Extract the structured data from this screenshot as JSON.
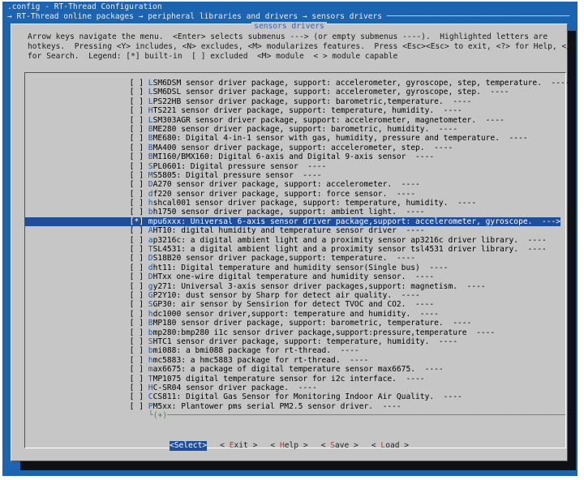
{
  "header": {
    "config_title": ".config - RT-Thread Configuration",
    "breadcrumb": "→ RT-Thread online packages → peripheral libraries and drivers → sensors drivers ───────────────────────────────────────"
  },
  "dialog": {
    "title": "sensors drivers",
    "help_lines": [
      "Arrow keys navigate the menu.  <Enter> selects submenus ---> (or empty submenus ----).  Highlighted letters are",
      "hotkeys.  Pressing <Y> includes, <N> excludes, <M> modularizes features.  Press <Esc><Esc> to exit, <?> for Help, </>",
      "for Search.  Legend: [*] built-in  [ ] excluded  <M> module  < > module capable"
    ]
  },
  "menu": {
    "items": [
      {
        "mark": "[ ]",
        "hot": "L",
        "rest": "SM6DSM sensor driver package, support: accelerometer, gyroscope, step, temperature.  ----"
      },
      {
        "mark": "[ ]",
        "hot": "L",
        "rest": "SM6DSL sensor driver package, support: accelerometer, gyroscope, step.  ----"
      },
      {
        "mark": "[ ]",
        "hot": "L",
        "rest": "PS22HB sensor driver package, support: barometric,temperature.  ----"
      },
      {
        "mark": "[ ]",
        "hot": "H",
        "rest": "TS221 sensor driver package, support: temperature, humidity.  ----"
      },
      {
        "mark": "[ ]",
        "hot": "L",
        "rest": "SM303AGR sensor driver package, support: accelerometer, magnetometer.  ----"
      },
      {
        "mark": "[ ]",
        "hot": "B",
        "rest": "ME280 sensor driver package, support: barometric, humidity.  ----"
      },
      {
        "mark": "[ ]",
        "hot": "B",
        "rest": "ME680: Digital 4-in-1 sensor with gas, humidity, pressure and temperature.  ----"
      },
      {
        "mark": "[ ]",
        "hot": "B",
        "rest": "MA400 sensor driver package, support: accelerometer, step.  ----"
      },
      {
        "mark": "[ ]",
        "hot": "B",
        "rest": "MI160/BMX160: Digital 6-axis and Digital 9-axis sensor  ----"
      },
      {
        "mark": "[ ]",
        "hot": "S",
        "rest": "PL0601: Digital pressure sensor  ----"
      },
      {
        "mark": "[ ]",
        "hot": "M",
        "rest": "S5805: Digital pressure sensor  ----"
      },
      {
        "mark": "[ ]",
        "hot": "D",
        "rest": "A270 sensor driver package, support: accelerometer.  ----"
      },
      {
        "mark": "[ ]",
        "hot": "d",
        "rest": "f220 sensor driver package, support: force sensor.  ----"
      },
      {
        "mark": "[ ]",
        "hot": "h",
        "rest": "shcal001 sensor driver package, support: temperature, humidity.  ----"
      },
      {
        "mark": "[ ]",
        "hot": "b",
        "rest": "h1750 sensor driver package, support: ambient light.  ----"
      },
      {
        "mark": "[*]",
        "hot": "m",
        "rest": "pu6xxx: Universal 6-axis sensor driver package,support: accelerometer, gyroscope.  --->",
        "selected": true
      },
      {
        "mark": "[ ]",
        "hot": "A",
        "rest": "HT10: digital humidity and temperature sensor driver  ----"
      },
      {
        "mark": "[ ]",
        "hot": "a",
        "rest": "p3216c: a digital ambient light and a proximity sensor ap3216c driver library.  ----"
      },
      {
        "mark": "[ ]",
        "hot": "T",
        "rest": "SL4531: a digital ambient light and a proximity sensor tsl4531 driver library.  ----"
      },
      {
        "mark": "[ ]",
        "hot": "D",
        "rest": "S18B20 sensor driver package,support: temperature.  ----"
      },
      {
        "mark": "[ ]",
        "hot": "d",
        "rest": "ht11: Digital temperature and humidity sensor(Single bus)  ----"
      },
      {
        "mark": "[ ]",
        "hot": "D",
        "rest": "HTxx one-wire digital temperature and humidity sensor.  ----"
      },
      {
        "mark": "[ ]",
        "hot": "g",
        "rest": "y271: Universal 3-axis sensor driver packages,support: magnetism.  ----"
      },
      {
        "mark": "[ ]",
        "hot": "G",
        "rest": "P2Y10: dust sensor by Sharp for detect air quality.  ----"
      },
      {
        "mark": "[ ]",
        "hot": "S",
        "rest": "GP30: air sensor by Sensirion for detect TVOC and CO2.  ----"
      },
      {
        "mark": "[ ]",
        "hot": "h",
        "rest": "dc1000 sensor driver,support: temperature and humidity.  ----"
      },
      {
        "mark": "[ ]",
        "hot": "B",
        "rest": "MP180 sensor driver package, support: barometric, temperature.  ----"
      },
      {
        "mark": "[ ]",
        "hot": "b",
        "rest": "mp280:bmp280 i1c sensor driver package,support:pressure,temperature  ----"
      },
      {
        "mark": "[ ]",
        "hot": "S",
        "rest": "HTC1 sensor driver package, support: temperature, humidity.  ----"
      },
      {
        "mark": "[ ]",
        "hot": "b",
        "rest": "mi088: a bmi088 package for rt-thread.  ----"
      },
      {
        "mark": "[ ]",
        "hot": "h",
        "rest": "mc5883: a hmc5883 package for rt-thread.  ----"
      },
      {
        "mark": "[ ]",
        "hot": "m",
        "rest": "ax6675: a package of digital temperature sensor max6675.  ----"
      },
      {
        "mark": "[ ]",
        "hot": "T",
        "rest": "MP1075 digital temperature sensor for i2c interface.  ----"
      },
      {
        "mark": "[ ]",
        "hot": "H",
        "rest": "C-SR04 sensor driver package.  ----"
      },
      {
        "mark": "[ ]",
        "hot": "C",
        "rest": "CS811: Digital Gas Sensor for Monitoring Indoor Air Quality.  ----"
      },
      {
        "mark": "[ ]",
        "hot": "P",
        "rest": "M5xx: Plantower pms serial PM2.5 sensor driver.  ----"
      }
    ],
    "scroll_indicator": "└(+)─────────────────────────────────────────────────────────────────────────────────────"
  },
  "buttons": [
    {
      "pre": "<",
      "hot": "S",
      "post": "elect>",
      "active": true,
      "name": "select-button"
    },
    {
      "pre": "< ",
      "hot": "E",
      "post": "xit >",
      "active": false,
      "name": "exit-button"
    },
    {
      "pre": "< ",
      "hot": "H",
      "post": "elp >",
      "active": false,
      "name": "help-button"
    },
    {
      "pre": "< ",
      "hot": "S",
      "post": "ave >",
      "active": false,
      "name": "save-button"
    },
    {
      "pre": "< ",
      "hot": "L",
      "post": "oad >",
      "active": false,
      "name": "load-button"
    }
  ]
}
